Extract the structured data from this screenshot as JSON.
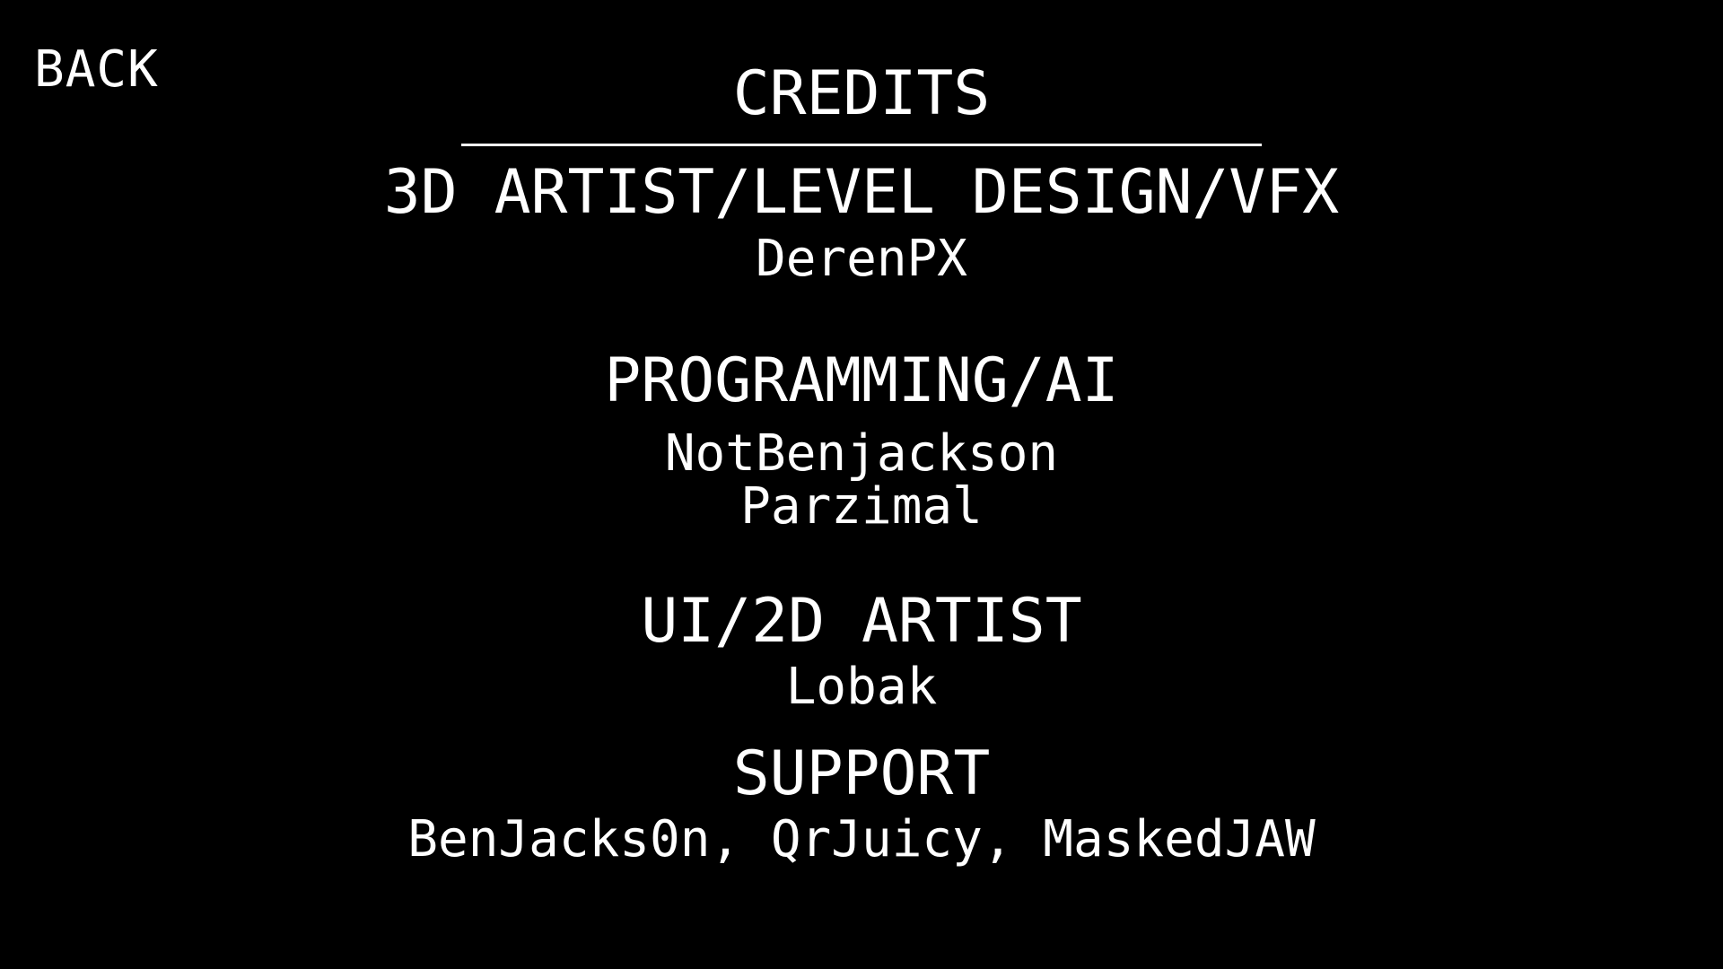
{
  "back_label": "BACK",
  "title": "CREDITS",
  "sections": [
    {
      "role": "3D ARTIST/LEVEL DESIGN/VFX",
      "names": [
        "DerenPX"
      ]
    },
    {
      "role": "PROGRAMMING/AI",
      "names": [
        "NotBenjackson",
        "Parzimal"
      ]
    },
    {
      "role": "UI/2D ARTIST",
      "names": [
        "Lobak"
      ]
    },
    {
      "role": "SUPPORT",
      "names": [
        "BenJacks0n, QrJuicy, MaskedJAW"
      ]
    }
  ],
  "colors": {
    "background": "#000000",
    "text": "#ffffff"
  }
}
